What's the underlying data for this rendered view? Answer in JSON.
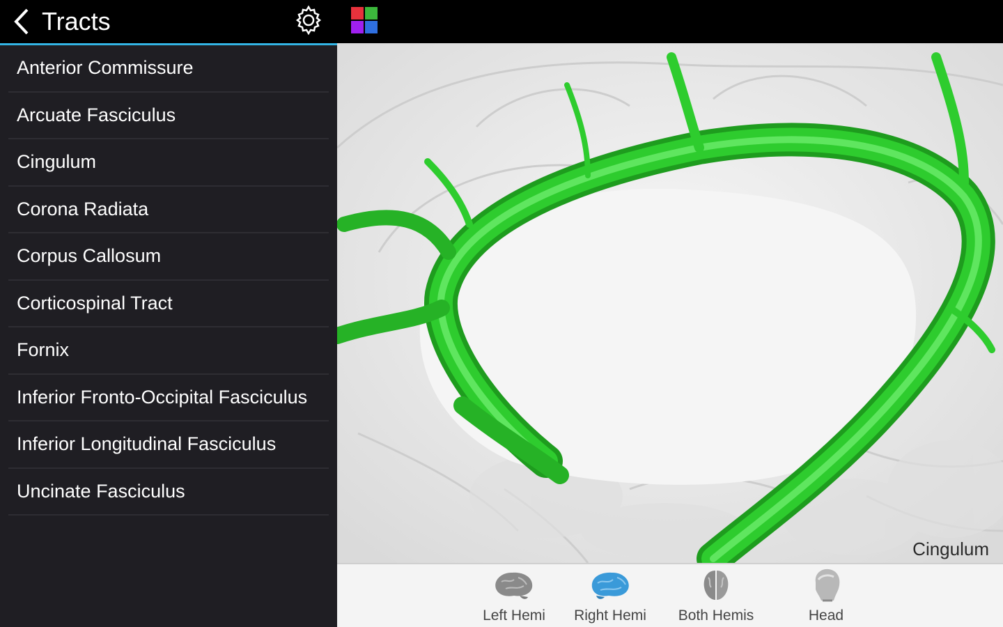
{
  "header": {
    "title": "Tracts",
    "back_icon": "chevron-left-icon",
    "settings_icon": "gear-icon",
    "apps_icon": "color-grid-icon",
    "accent_color": "#33b5e5",
    "grid_colors": [
      "#e8323c",
      "#3cb83c",
      "#a020f0",
      "#2f6fe0"
    ]
  },
  "sidebar": {
    "items": [
      {
        "label": "Anterior Commissure"
      },
      {
        "label": "Arcuate Fasciculus"
      },
      {
        "label": "Cingulum"
      },
      {
        "label": "Corona Radiata"
      },
      {
        "label": "Corpus Callosum"
      },
      {
        "label": "Corticospinal Tract"
      },
      {
        "label": "Fornix"
      },
      {
        "label": "Inferior Fronto-Occipital Fasciculus"
      },
      {
        "label": "Inferior Longitudinal Fasciculus"
      },
      {
        "label": "Uncinate Fasciculus"
      }
    ]
  },
  "viewer": {
    "current_tract": "Cingulum",
    "tract_color": "#2ecc2e"
  },
  "bottom_bar": {
    "buttons": [
      {
        "label": "Left Hemi",
        "icon": "left-hemisphere-brain-icon",
        "color": "#8a8a8a"
      },
      {
        "label": "Right Hemi",
        "icon": "right-hemisphere-brain-icon",
        "color": "#3a9ad9"
      },
      {
        "label": "Both Hemis",
        "icon": "both-hemispheres-brain-icon",
        "color": "#8a8a8a"
      },
      {
        "label": "Head",
        "icon": "head-icon",
        "color": "#9a9a9a"
      }
    ]
  }
}
